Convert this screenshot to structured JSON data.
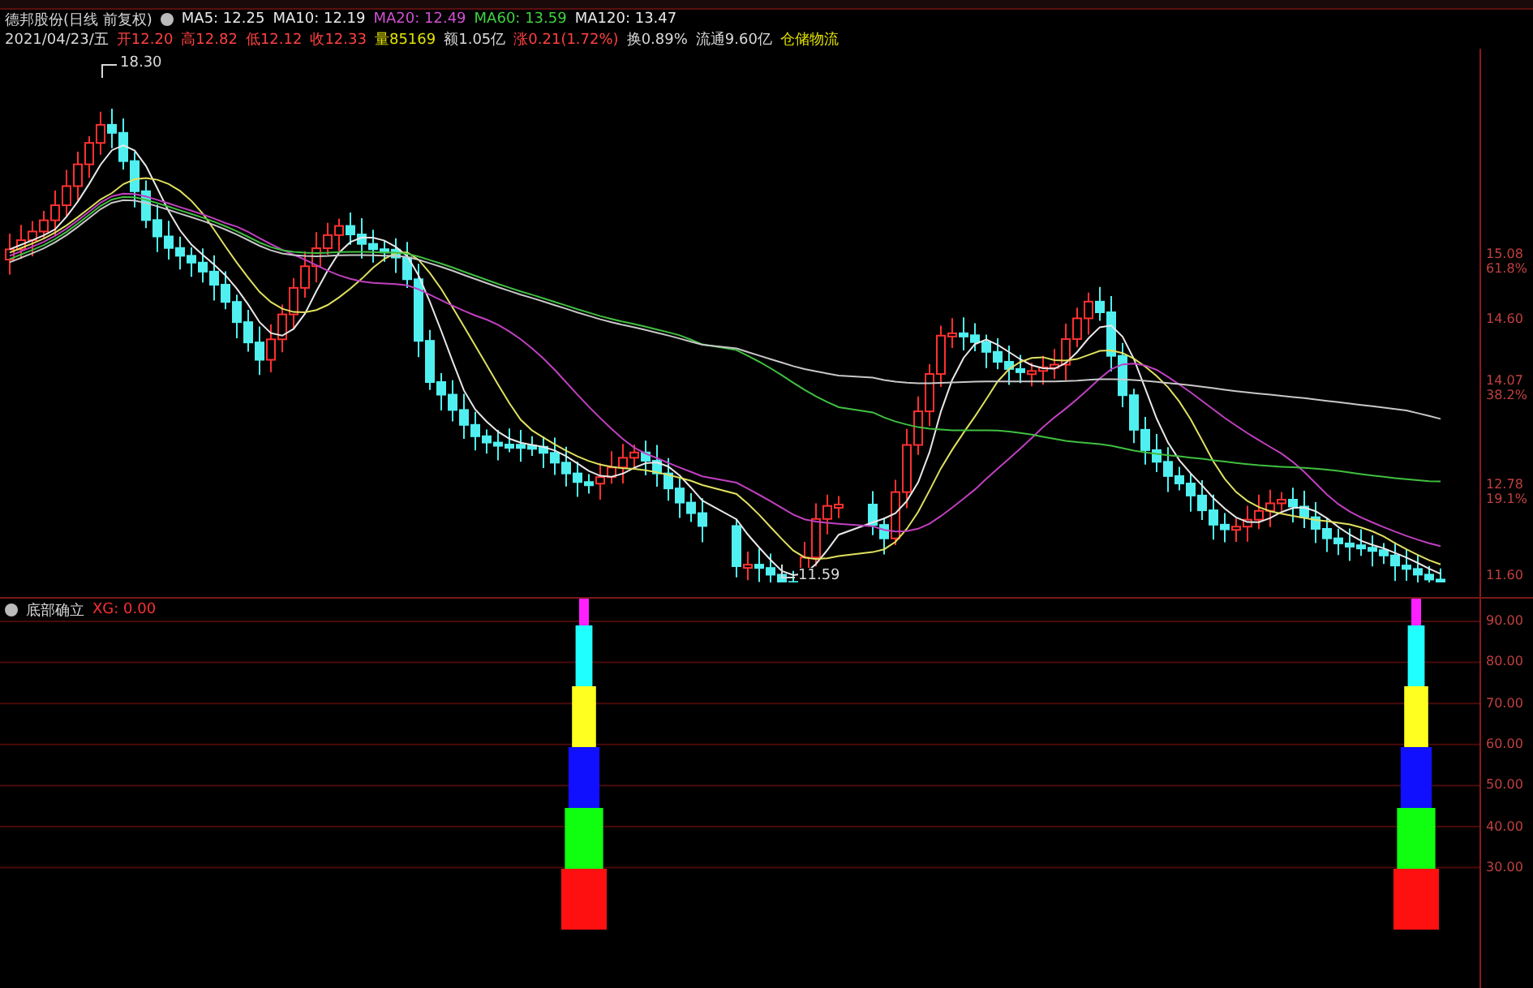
{
  "title": "德邦股份(日线 前复权)",
  "ma_items": [
    {
      "label": "MA5: 12.25",
      "color": "#e8e8e8"
    },
    {
      "label": "MA10: 12.19",
      "color": "#e8e8e8"
    },
    {
      "label": "MA20: 12.49",
      "color": "#d050d0"
    },
    {
      "label": "MA60: 13.59",
      "color": "#40d040"
    },
    {
      "label": "MA120: 13.47",
      "color": "#e8e8e8"
    }
  ],
  "quote": [
    {
      "text": "2021/04/23/五",
      "color": "#d8d8d8"
    },
    {
      "text": "开12.20",
      "color": "#ff4040"
    },
    {
      "text": "高12.82",
      "color": "#ff4040"
    },
    {
      "text": "低12.12",
      "color": "#ff4040"
    },
    {
      "text": "收12.33",
      "color": "#ff4040"
    },
    {
      "text": "量85169",
      "color": "#e0e000"
    },
    {
      "text": "额1.05亿",
      "color": "#d8d8d8"
    },
    {
      "text": "涨0.21(1.72%)",
      "color": "#ff4040"
    },
    {
      "text": "换0.89%",
      "color": "#d8d8d8"
    },
    {
      "text": "流通9.60亿",
      "color": "#d8d8d8"
    },
    {
      "text": "仓储物流",
      "color": "#e0e000"
    }
  ],
  "price_markers": [
    {
      "label": "18.30"
    },
    {
      "label": "11.59"
    }
  ],
  "price_axis": [
    {
      "value": "15.08",
      "percent": "61.8%"
    },
    {
      "value": "14.60"
    },
    {
      "value": "14.07",
      "percent": "38.2%"
    },
    {
      "value": "12.78",
      "percent": "19.1%"
    },
    {
      "value": "11.60"
    }
  ],
  "indicator": {
    "name": "底部确立",
    "reading": "XG: 0.00"
  },
  "indicator_axis": [
    "90.00",
    "80.00",
    "70.00",
    "60.00",
    "50.00",
    "40.00",
    "30.00"
  ]
}
